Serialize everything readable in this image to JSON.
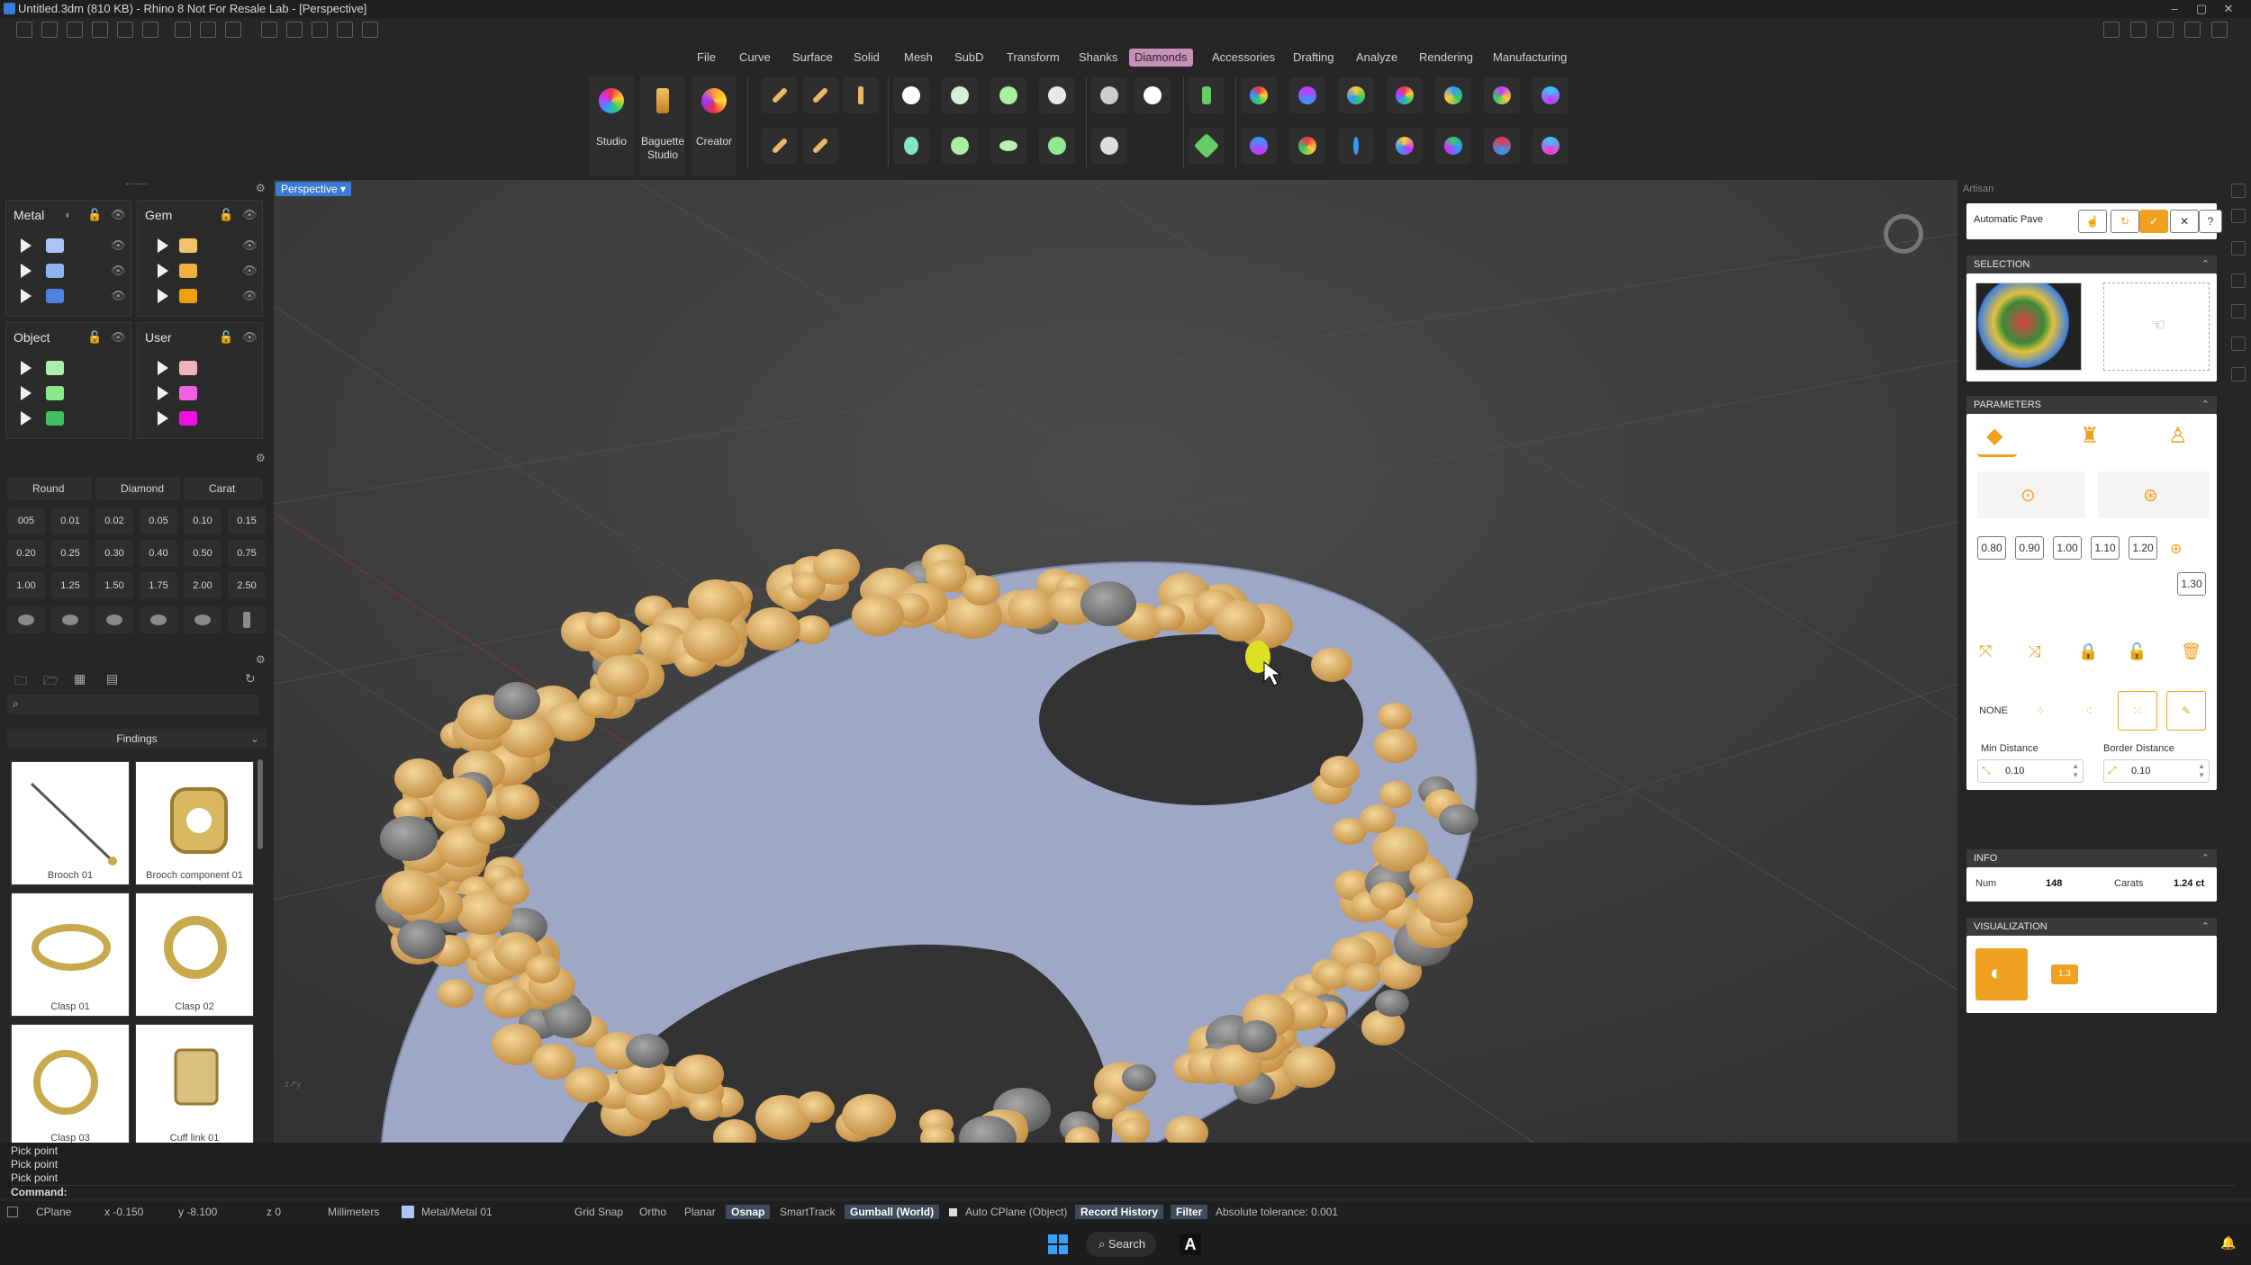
{
  "window": {
    "title": "Untitled.3dm (810 KB) - Rhino 8 Not For Resale Lab - [Perspective]"
  },
  "menu": {
    "items": [
      "File",
      "Curve",
      "Surface",
      "Solid",
      "Mesh",
      "SubD",
      "Transform",
      "Shanks",
      "Diamonds",
      "Accessories",
      "Drafting",
      "Analyze",
      "Rendering",
      "Manufacturing"
    ],
    "active": "Diamonds"
  },
  "ribbon": {
    "studio": "Studio",
    "baguette": "Baguette Studio",
    "creator": "Creator"
  },
  "layers": {
    "metal": "Metal",
    "gem": "Gem",
    "object": "Object",
    "user": "User",
    "metal_colors": [
      "#a9c4f5",
      "#8db3f0",
      "#4f7fe0"
    ],
    "gem_colors": [
      "#f2c46a",
      "#f0b040",
      "#f0a010"
    ],
    "object_colors": [
      "#a8f0a8",
      "#88e888",
      "#40c060"
    ],
    "user_colors": [
      "#f5b0c0",
      "#f060e0",
      "#ee10e0"
    ]
  },
  "gems": {
    "tabs": [
      "Round",
      "Diamond",
      "Carat"
    ],
    "sizes": [
      "005",
      "0.01",
      "0.02",
      "0.05",
      "0.10",
      "0.15",
      "0.20",
      "0.25",
      "0.30",
      "0.40",
      "0.50",
      "0.75",
      "1.00",
      "1.25",
      "1.50",
      "1.75",
      "2.00",
      "2.50"
    ]
  },
  "findings": {
    "title": "Findings",
    "items": [
      "Brooch 01",
      "Brooch component 01",
      "Clasp 01",
      "Clasp 02",
      "Clasp 03",
      "Cuff link 01"
    ]
  },
  "viewport": {
    "label": "Perspective"
  },
  "artisan": {
    "title": "Artisan",
    "tool": "Automatic Pave",
    "selection_header": "SELECTION",
    "parameters_header": "PARAMETERS",
    "scales": [
      "0.80",
      "0.90",
      "1.00",
      "1.10",
      "1.20",
      "1.30"
    ],
    "none_label": "NONE",
    "min_distance_label": "Min Distance",
    "border_distance_label": "Border Distance",
    "min_distance": "0.10",
    "border_distance": "0.10",
    "info_header": "INFO",
    "num_label": "Num",
    "num": "148",
    "carats_label": "Carats",
    "carats": "1.24 ct",
    "visualization_header": "VISUALIZATION",
    "vis_badge": "1.3"
  },
  "command": {
    "history": [
      "Pick point",
      "Pick point",
      "Pick point"
    ],
    "prompt": "Command:"
  },
  "status": {
    "cplane": "CPlane",
    "x": "x -0.150",
    "y": "y -8.100",
    "z": "z 0",
    "units": "Millimeters",
    "layer": "Metal/Metal 01",
    "grid_snap": "Grid Snap",
    "ortho": "Ortho",
    "planar": "Planar",
    "osnap": "Osnap",
    "smarttrack": "SmartTrack",
    "gumball": "Gumball (World)",
    "auto_cplane": "Auto CPlane (Object)",
    "record_history": "Record History",
    "filter": "Filter",
    "tolerance": "Absolute tolerance: 0.001"
  },
  "taskbar": {
    "search": "Search"
  }
}
